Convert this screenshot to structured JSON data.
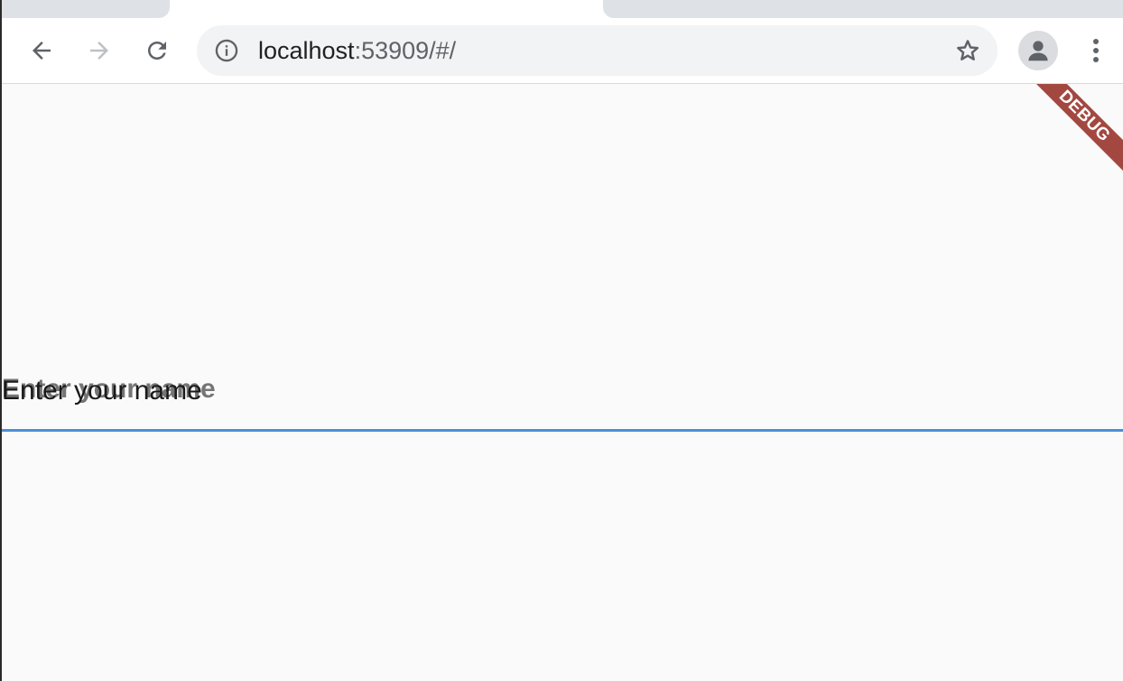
{
  "browser": {
    "url_host": "localhost",
    "url_rest": ":53909/#/",
    "icons": {
      "back": "arrow-left-icon",
      "forward": "arrow-right-icon",
      "reload": "reload-icon",
      "site_info": "info-icon",
      "bookmark": "star-icon",
      "profile": "person-icon",
      "menu": "kebab-menu-icon"
    }
  },
  "app": {
    "debug_banner": "DEBUG",
    "name_field": {
      "label": "Enter your name",
      "hint": "Enter your name",
      "value": ""
    }
  },
  "colors": {
    "page_background": "#fafafa",
    "debug_banner": "#a34840",
    "field_underline": "#4a90d9",
    "label": "#757575"
  }
}
